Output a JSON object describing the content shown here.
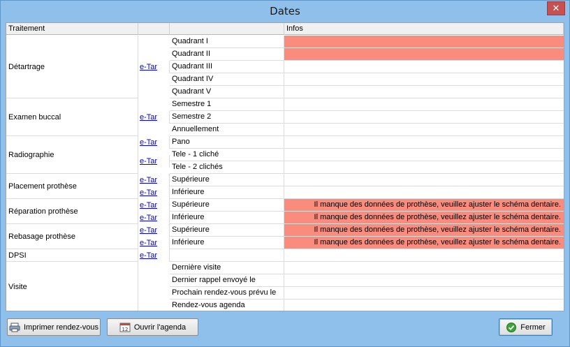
{
  "window": {
    "title": "Dates",
    "close_glyph": "✕"
  },
  "columns": {
    "treatment": "Traitement",
    "link": "",
    "item": "",
    "infos": "Infos"
  },
  "link_label": "e-Tar",
  "warn_color": "#fa8c7e",
  "groups": [
    {
      "label": "Détartrage",
      "etar": "e-Tar",
      "items": [
        {
          "label": "Quadrant I",
          "info": "",
          "warn": true
        },
        {
          "label": "Quadrant II",
          "info": "",
          "warn": true
        },
        {
          "label": "Quadrant III",
          "info": "",
          "warn": false
        },
        {
          "label": "Quadrant IV",
          "info": "",
          "warn": false
        },
        {
          "label": "Quadrant V",
          "info": "",
          "warn": false
        }
      ]
    },
    {
      "label": "Examen buccal",
      "etar": "e-Tar",
      "items": [
        {
          "label": "Semestre 1",
          "info": "",
          "warn": false
        },
        {
          "label": "Semestre 2",
          "info": "",
          "warn": false
        },
        {
          "label": "Annuellement",
          "info": "",
          "warn": false
        }
      ]
    },
    {
      "label": "Radiographie",
      "etar": "",
      "items": [
        {
          "label": "Pano",
          "info": "",
          "warn": false,
          "etar": "e-Tar"
        },
        {
          "label": "Tele - 1 cliché",
          "info": "",
          "warn": false,
          "etar": ""
        },
        {
          "label": "Tele - 2 clichés",
          "info": "",
          "warn": false,
          "etar": ""
        }
      ],
      "span_etar": "e-Tar"
    },
    {
      "label": "Placement prothèse",
      "items": [
        {
          "label": "Supérieure",
          "info": "",
          "warn": false,
          "etar": "e-Tar"
        },
        {
          "label": "Inférieure",
          "info": "",
          "warn": false,
          "etar": "e-Tar"
        }
      ]
    },
    {
      "label": "Réparation prothèse",
      "items": [
        {
          "label": "Supérieure",
          "info": "Il manque des données de prothèse, veuillez ajuster le schéma dentaire.",
          "warn": true,
          "etar": "e-Tar"
        },
        {
          "label": "Inférieure",
          "info": "Il manque des données de prothèse, veuillez ajuster le schéma dentaire.",
          "warn": true,
          "etar": "e-Tar"
        }
      ]
    },
    {
      "label": "Rebasage prothèse",
      "items": [
        {
          "label": "Supérieure",
          "info": "Il manque des données de prothèse, veuillez ajuster le schéma dentaire.",
          "warn": true,
          "etar": "e-Tar"
        },
        {
          "label": "Inférieure",
          "info": "Il manque des données de prothèse, veuillez ajuster le schéma dentaire.",
          "warn": true,
          "etar": "e-Tar"
        }
      ]
    },
    {
      "label": "DPSI",
      "items": [
        {
          "label": "",
          "info": "",
          "warn": false,
          "etar": "e-Tar"
        }
      ]
    },
    {
      "label": "Visite",
      "items": [
        {
          "label": "Dernière visite",
          "info": "",
          "warn": false,
          "etar": ""
        },
        {
          "label": "Dernier rappel envoyé le",
          "info": "",
          "warn": false,
          "etar": ""
        },
        {
          "label": "Prochain rendez-vous prévu le",
          "info": "",
          "warn": false,
          "etar": ""
        },
        {
          "label": "Rendez-vous agenda",
          "info": "",
          "warn": false,
          "etar": ""
        }
      ]
    }
  ],
  "footer": {
    "print_label": "Imprimer rendez-vous",
    "print_icon": "printer-icon",
    "agenda_label": "Ouvrir l'agenda",
    "agenda_icon": "calendar-icon",
    "close_label": "Fermer",
    "close_icon": "checkmark-icon"
  }
}
